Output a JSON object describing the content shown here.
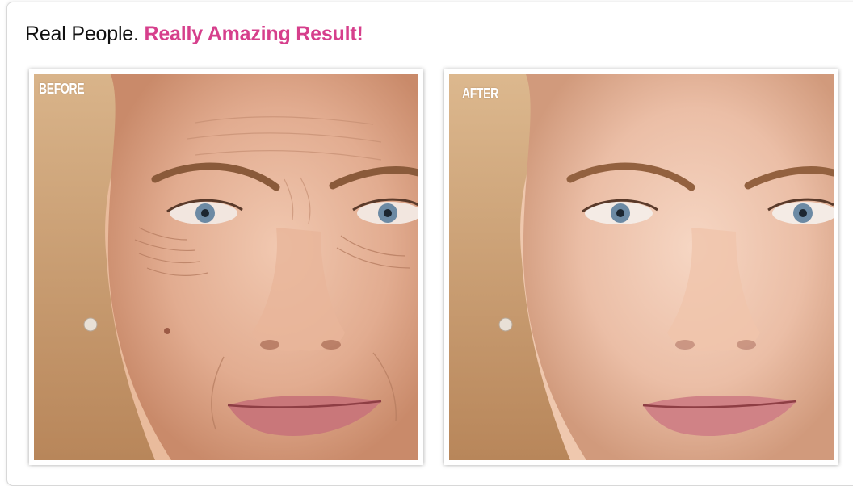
{
  "headline": {
    "prefix": "Real People. ",
    "highlight": "Really Amazing Result!",
    "highlight_color": "#d63f8c"
  },
  "photos": [
    {
      "label": "BEFORE",
      "description_icon": "face-photo-before"
    },
    {
      "label": "AFTER",
      "description_icon": "face-photo-after"
    }
  ]
}
